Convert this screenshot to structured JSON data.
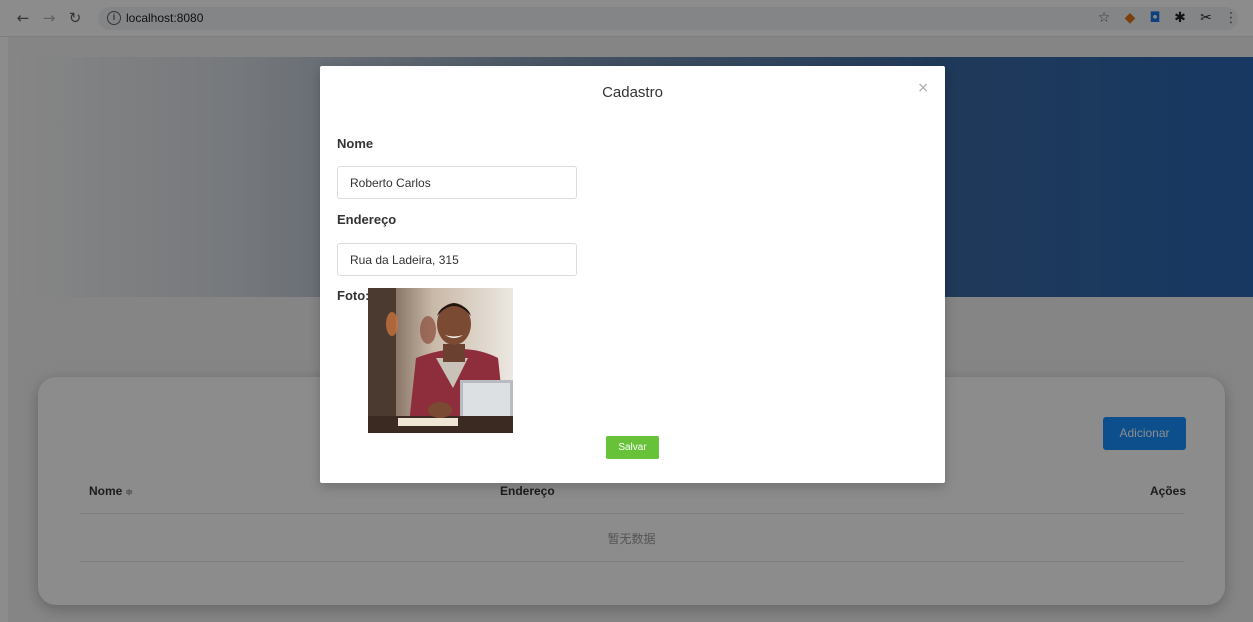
{
  "browser": {
    "url": "localhost:8080",
    "back_icon": "arrow-left-icon",
    "forward_icon": "arrow-right-icon",
    "reload_icon": "reload-icon",
    "info_icon": "info-icon",
    "extensions": [
      "star-icon",
      "fox-icon",
      "shield-icon",
      "puzzle-icon",
      "scissors-icon",
      "menu-dots-icon"
    ]
  },
  "page": {
    "add_button": "Adicionar",
    "table": {
      "headers": [
        "Nome",
        "Endereço",
        "Ações"
      ],
      "sort_icon": "≑",
      "empty_text": "暂无数据"
    }
  },
  "modal": {
    "title": "Cadastro",
    "close": "×",
    "name_label": "Nome",
    "name_value": "Roberto Carlos",
    "address_label": "Endereço",
    "address_value": "Rua da Ladeira, 315",
    "photo_label": "Foto:",
    "save_button": "Salvar"
  },
  "colors": {
    "primary": "#1890ff",
    "success": "#67c23a",
    "hero_end": "#2b67b4"
  }
}
